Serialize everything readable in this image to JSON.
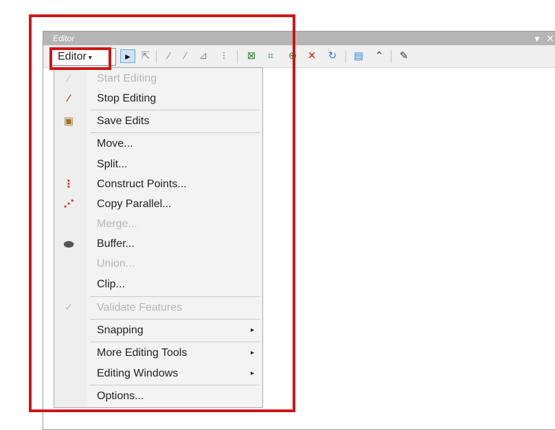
{
  "window": {
    "title": "Editor",
    "controls": [
      "▾",
      "✕"
    ]
  },
  "toolbar": {
    "editor_label": "Editor",
    "editor_arrow": "▾",
    "tools": [
      {
        "name": "edit-tool-icon",
        "glyph": "▸"
      },
      {
        "name": "edit-annotation-tool-icon",
        "glyph": "⇱"
      },
      {
        "name": "straight-segment-icon",
        "glyph": "⁄"
      },
      {
        "name": "end-point-arc-icon",
        "glyph": "⁄"
      },
      {
        "name": "trace-icon",
        "glyph": "⊿"
      },
      {
        "name": "point-icon",
        "glyph": "⁝"
      },
      {
        "name": "edit-vertices-icon",
        "glyph": "⊠"
      },
      {
        "name": "reshape-feature-icon",
        "glyph": "⌗"
      },
      {
        "name": "cut-polygons-icon",
        "glyph": "⊕"
      },
      {
        "name": "split-tool-icon",
        "glyph": "✕"
      },
      {
        "name": "rotate-tool-icon",
        "glyph": "↻"
      },
      {
        "name": "attributes-icon",
        "glyph": "▤"
      },
      {
        "name": "sketch-properties-icon",
        "glyph": "⌃"
      },
      {
        "name": "create-features-icon",
        "glyph": "✎"
      }
    ]
  },
  "menu": {
    "items": [
      {
        "label": "Start Editing",
        "icon": "pencil-icon",
        "glyph": "⁄",
        "disabled": true
      },
      {
        "label": "Stop Editing",
        "icon": "stop-editing-icon",
        "glyph": "⁄",
        "disabled": false
      },
      {
        "label": "Save Edits",
        "icon": "save-edits-icon",
        "glyph": "▣",
        "disabled": false
      },
      {
        "label": "Move...",
        "disabled": false
      },
      {
        "label": "Split...",
        "disabled": false
      },
      {
        "label": "Construct Points...",
        "icon": "construct-points-icon",
        "glyph": "⋮",
        "disabled": false
      },
      {
        "label": "Copy Parallel...",
        "icon": "copy-parallel-icon",
        "glyph": "⋰",
        "disabled": false
      },
      {
        "label": "Merge...",
        "disabled": true
      },
      {
        "label": "Buffer...",
        "icon": "buffer-icon",
        "glyph": "⬬",
        "disabled": false
      },
      {
        "label": "Union...",
        "disabled": true
      },
      {
        "label": "Clip...",
        "disabled": false
      },
      {
        "label": "Validate Features",
        "icon": "validate-features-icon",
        "glyph": "✓",
        "disabled": true
      },
      {
        "label": "Snapping",
        "submenu": true,
        "disabled": false
      },
      {
        "label": "More Editing Tools",
        "submenu": true,
        "disabled": false
      },
      {
        "label": "Editing Windows",
        "submenu": true,
        "disabled": false
      },
      {
        "label": "Options...",
        "disabled": false
      }
    ],
    "submenu_arrow": "▸"
  },
  "annotations": {
    "highlight_color": "#d21414"
  }
}
